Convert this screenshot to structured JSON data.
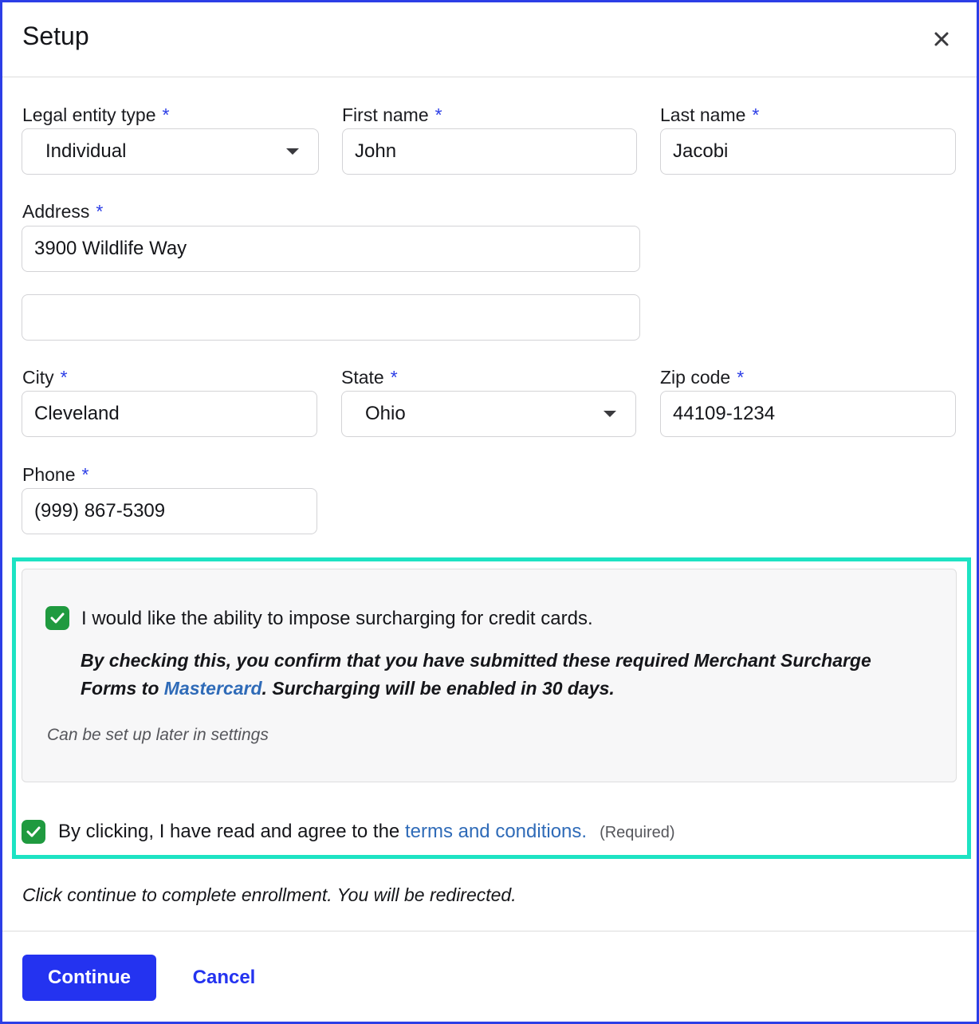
{
  "dialog": {
    "title": "Setup",
    "close_icon": "close-icon"
  },
  "form": {
    "required_marker": "*",
    "legal_entity_type": {
      "label": "Legal entity type",
      "value": "Individual"
    },
    "first_name": {
      "label": "First name",
      "value": "John"
    },
    "last_name": {
      "label": "Last name",
      "value": "Jacobi"
    },
    "address": {
      "label": "Address",
      "line1": "3900 Wildlife Way",
      "line2": ""
    },
    "city": {
      "label": "City",
      "value": "Cleveland"
    },
    "state": {
      "label": "State",
      "value": "Ohio"
    },
    "zip": {
      "label": "Zip code",
      "value": "44109-1234"
    },
    "phone": {
      "label": "Phone",
      "value": "(999) 867-5309"
    }
  },
  "surcharge": {
    "checked": true,
    "label": "I would like the ability to impose surcharging for credit cards.",
    "notice_prefix": "By checking this, you confirm that you have submitted these required Merchant Surcharge Forms to ",
    "notice_link": "Mastercard",
    "notice_suffix": ". Surcharging will be enabled in 30 days.",
    "hint": "Can be set up later in settings"
  },
  "terms": {
    "checked": true,
    "label_prefix": "By clicking, I have read and agree to the ",
    "link": "terms and conditions.",
    "required": "(Required)"
  },
  "redirect_note": "Click continue to complete enrollment. You will be redirected.",
  "footer": {
    "continue_label": "Continue",
    "cancel_label": "Cancel"
  },
  "colors": {
    "accent": "#2433f0",
    "checkbox": "#1f9a3f",
    "highlight": "#1de3c3",
    "link": "#2f6bb8"
  }
}
